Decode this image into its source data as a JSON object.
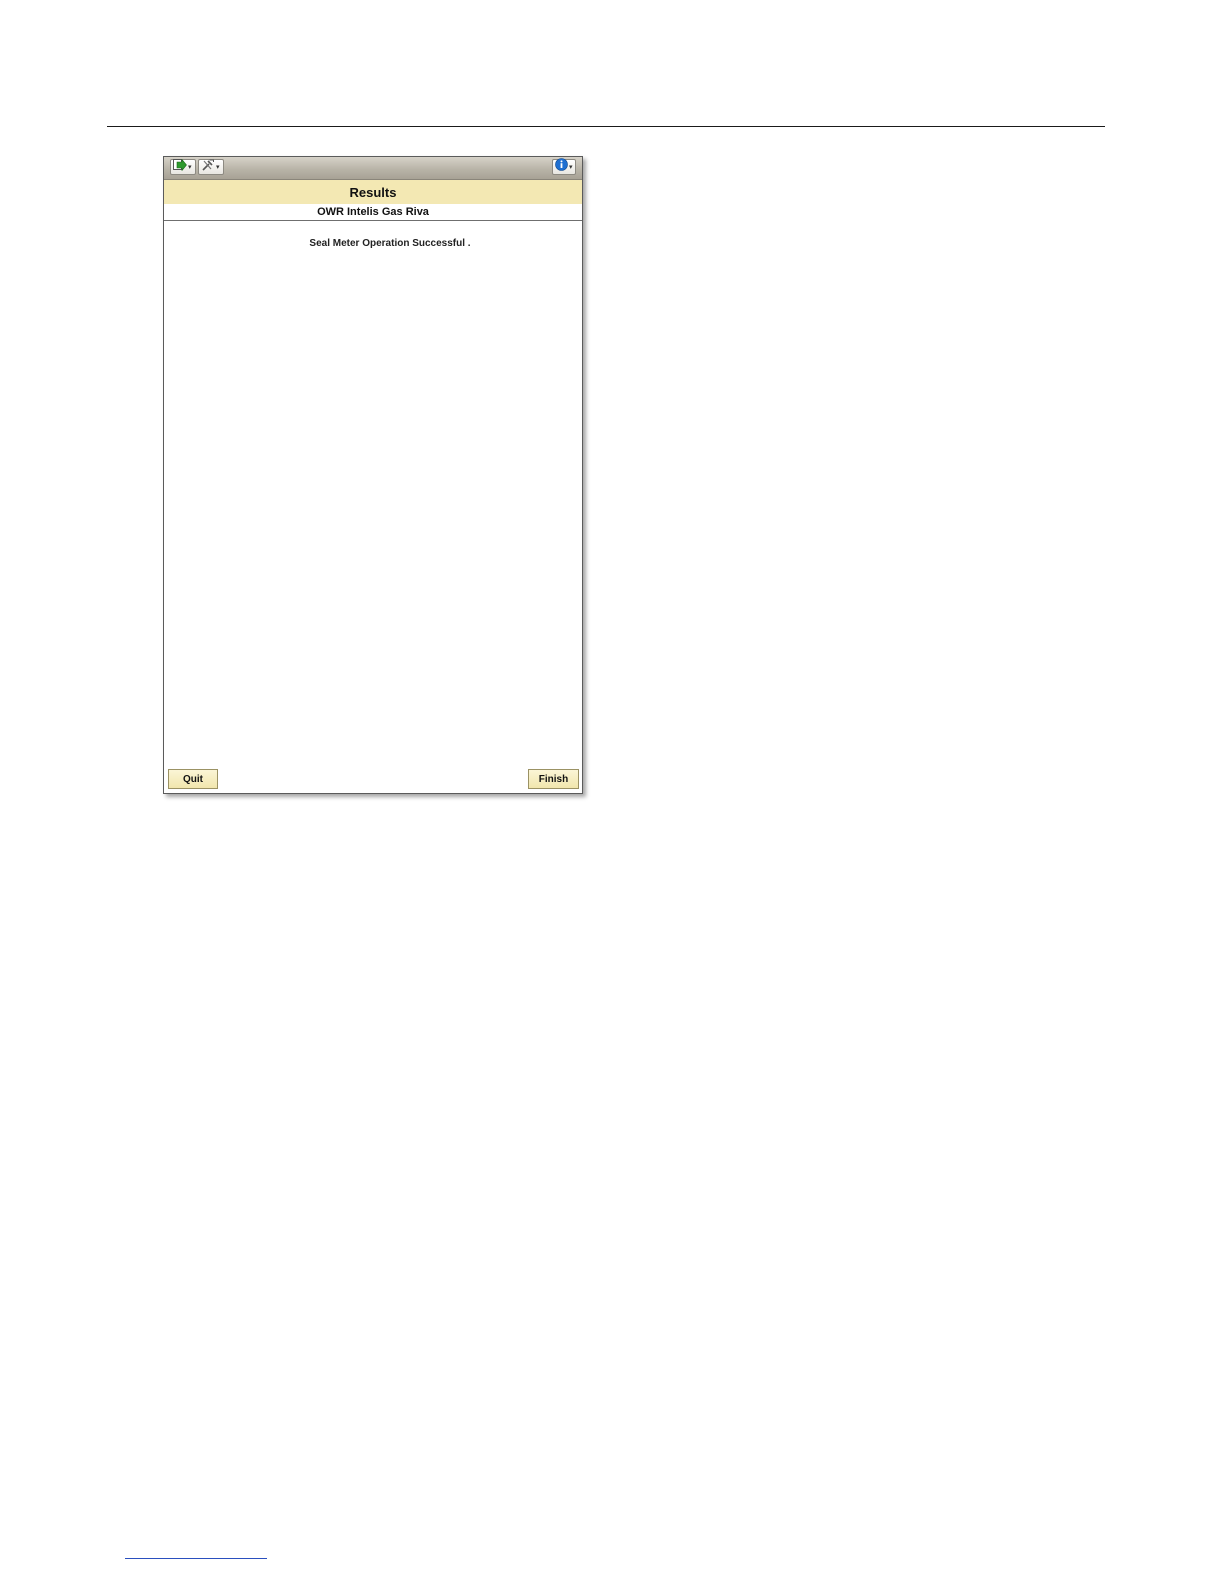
{
  "window": {
    "title": "Results",
    "subtitle": "OWR Intelis Gas Riva"
  },
  "toolbar": {
    "nav_icon": "navigate-arrow-icon",
    "tools_icon": "tools-icon",
    "info_icon": "info-icon"
  },
  "main": {
    "message": "Seal Meter Operation Successful ."
  },
  "footer": {
    "quit_label": "Quit",
    "finish_label": "Finish"
  },
  "colors": {
    "title_band": "#f3e8b3",
    "button_fill": "#f1e6ad",
    "toolbar": "#b9b4a8",
    "info_blue": "#1f6fd1"
  }
}
